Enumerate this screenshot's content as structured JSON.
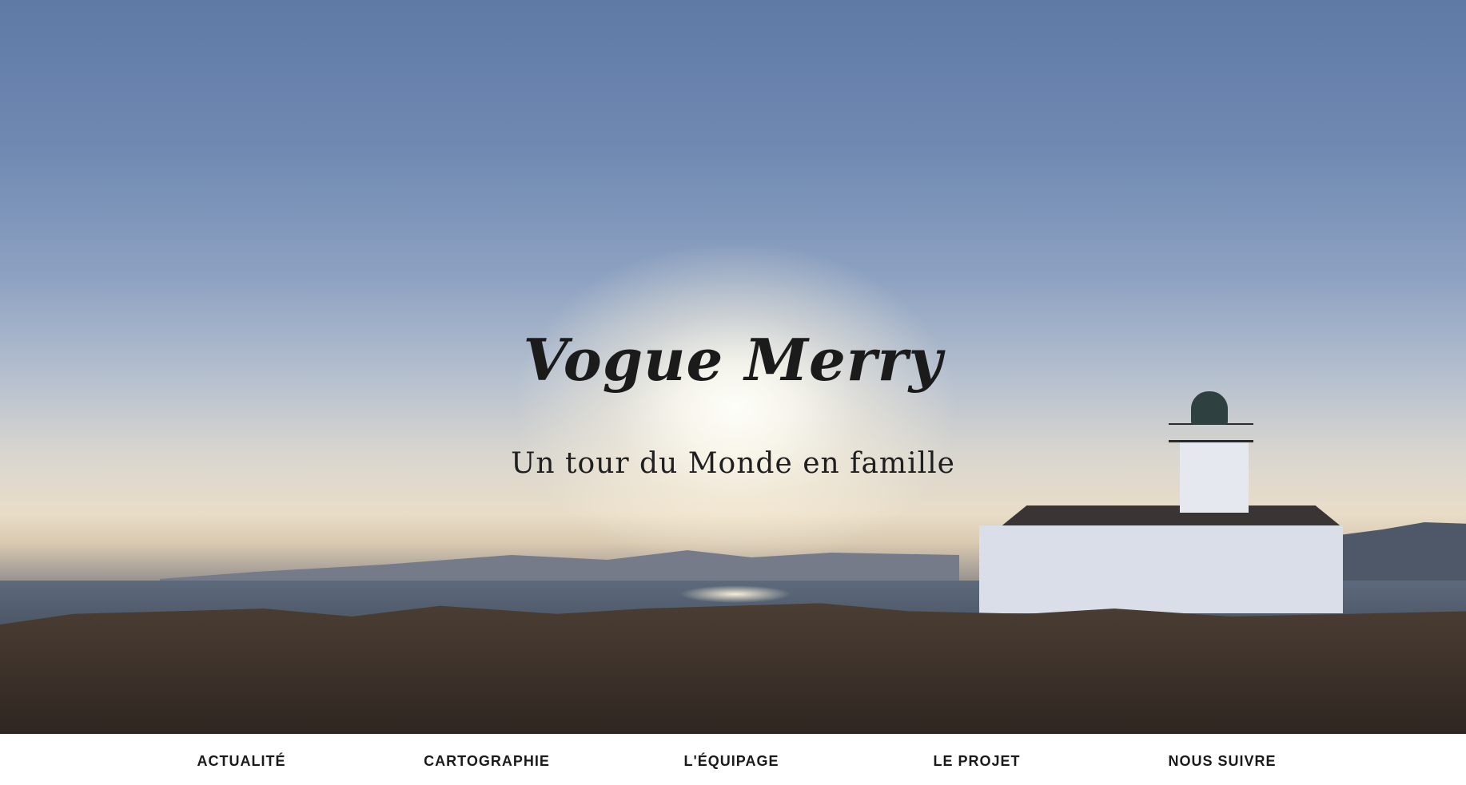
{
  "header": {
    "title": "Vogue Merry",
    "tagline": "Un tour du Monde en famille"
  },
  "nav": {
    "items": [
      {
        "label": "ACTUALITÉ"
      },
      {
        "label": "CARTOGRAPHIE"
      },
      {
        "label": "L'ÉQUIPAGE"
      },
      {
        "label": "LE PROJET"
      },
      {
        "label": "NOUS SUIVRE"
      }
    ]
  }
}
